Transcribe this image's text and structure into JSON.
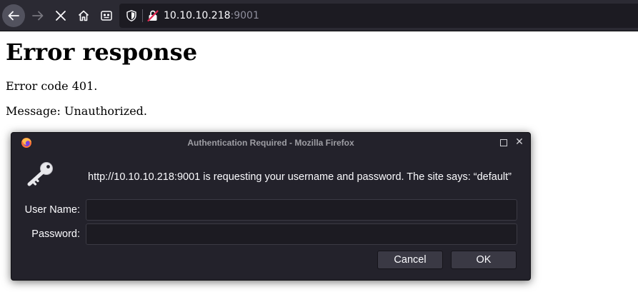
{
  "browser": {
    "url_host": "10.10.10.218",
    "url_port": ":9001",
    "icons": [
      "back-arrow-icon",
      "forward-arrow-icon",
      "stop-icon",
      "home-icon",
      "reader-view-icon",
      "shield-icon",
      "insecure-lock-icon"
    ]
  },
  "page": {
    "heading": "Error response",
    "error_code": "Error code 401.",
    "message": "Message: Unauthorized."
  },
  "dialog": {
    "title": "Authentication Required - Mozilla Firefox",
    "message": "http://10.10.10.218:9001 is requesting your username and password. The site says: “default”",
    "username_label": "User Name:",
    "username_value": "",
    "password_label": "Password:",
    "password_value": "",
    "cancel_label": "Cancel",
    "ok_label": "OK",
    "icons": [
      "firefox-icon",
      "maximize-icon",
      "close-icon",
      "key-icon"
    ]
  },
  "colors": {
    "toolbar_bg": "#2b2a33",
    "urlbar_bg": "#1c1b22",
    "dialog_bg": "#23222b",
    "lock_strike": "#e22850"
  }
}
